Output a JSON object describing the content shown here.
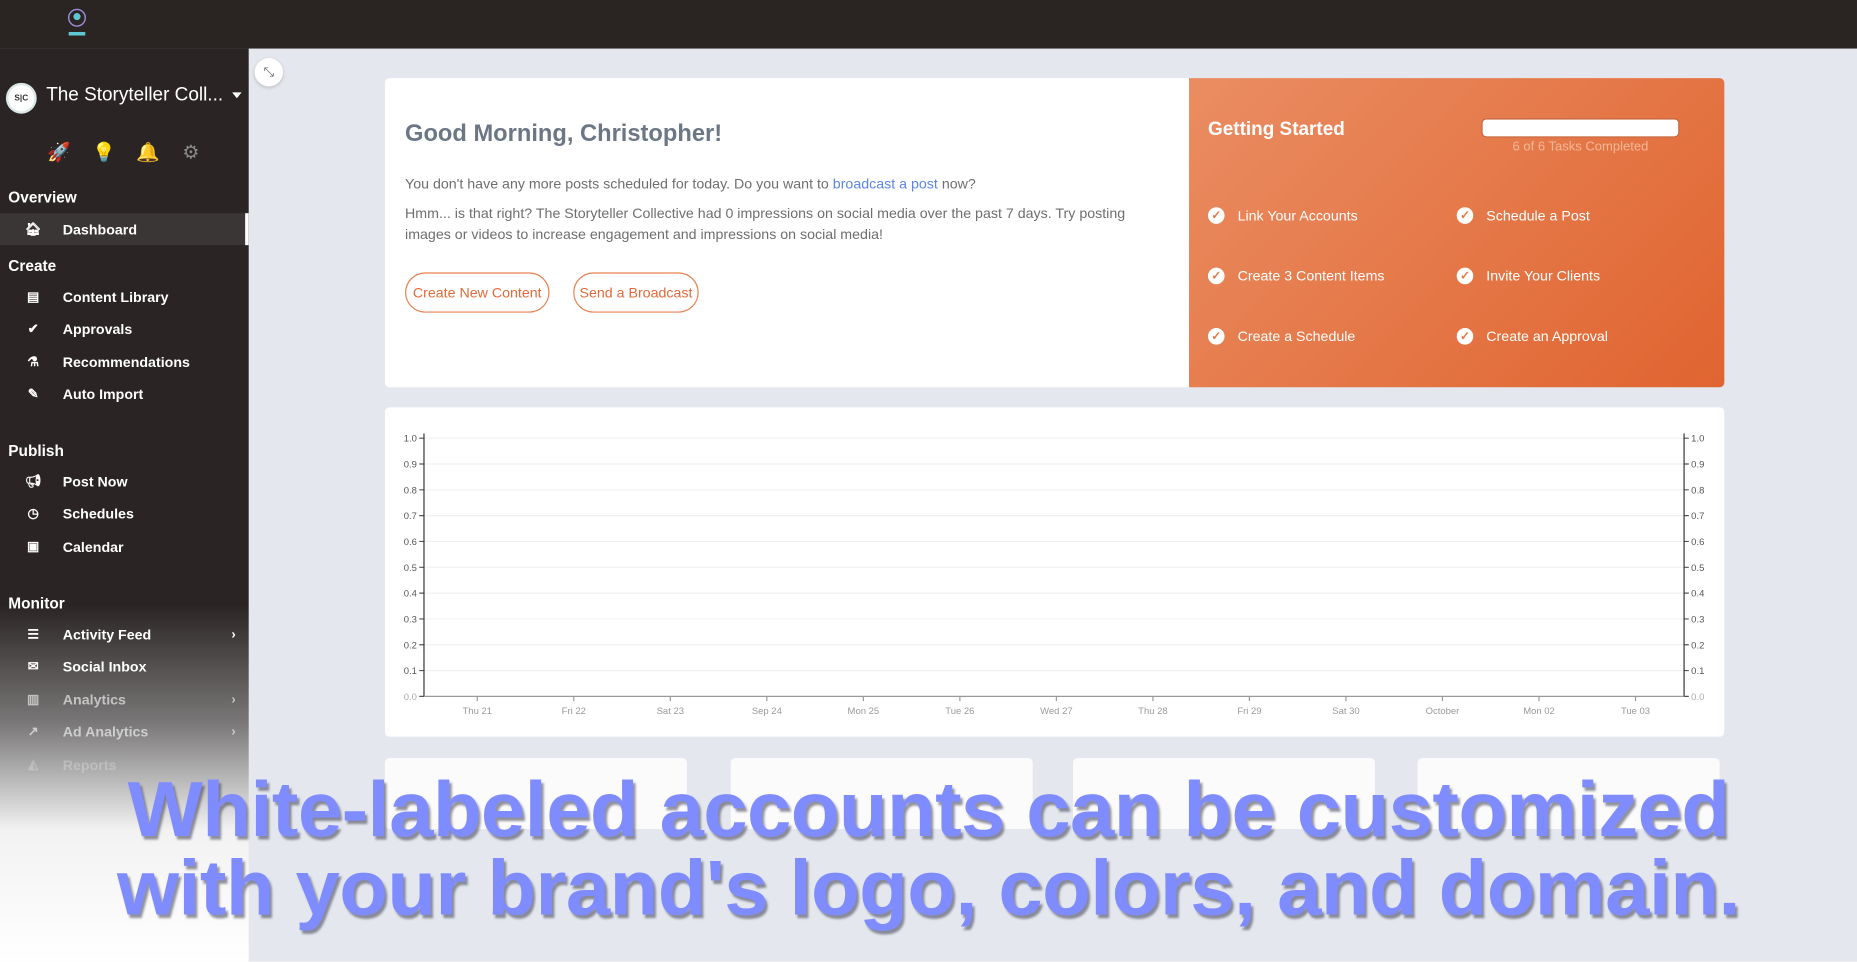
{
  "sidebar": {
    "account_initials": "S|C",
    "account_name": "The Storyteller Coll...",
    "top_icons": [
      "rocket-icon",
      "lightbulb-icon",
      "bell-icon",
      "gear-icon"
    ],
    "sections": [
      {
        "title": "Overview",
        "items": [
          {
            "label": "Dashboard",
            "icon": "home-icon",
            "active": true
          }
        ]
      },
      {
        "title": "Create",
        "items": [
          {
            "label": "Content Library",
            "icon": "image-file-icon"
          },
          {
            "label": "Approvals",
            "icon": "check-circle-icon"
          },
          {
            "label": "Recommendations",
            "icon": "flask-icon"
          },
          {
            "label": "Auto Import",
            "icon": "magic-wand-icon"
          }
        ]
      },
      {
        "title": "Publish",
        "items": [
          {
            "label": "Post Now",
            "icon": "megaphone-icon"
          },
          {
            "label": "Schedules",
            "icon": "clock-icon"
          },
          {
            "label": "Calendar",
            "icon": "calendar-check-icon"
          }
        ]
      },
      {
        "title": "Monitor",
        "items": [
          {
            "label": "Activity Feed",
            "icon": "list-icon",
            "chevron": true
          },
          {
            "label": "Social Inbox",
            "icon": "envelope-icon"
          },
          {
            "label": "Analytics",
            "icon": "bar-chart-icon",
            "chevron": true
          },
          {
            "label": "Ad Analytics",
            "icon": "line-chart-icon",
            "chevron": true
          },
          {
            "label": "Reports",
            "icon": "area-chart-icon"
          }
        ]
      }
    ]
  },
  "welcome": {
    "greeting": "Good Morning, Christopher!",
    "line1_pre": "You don't have any more posts scheduled for today. Do you want to ",
    "line1_link": "broadcast a post",
    "line1_post": " now?",
    "line2": "Hmm... is that right? The Storyteller Collective had 0 impressions on social media over the past 7 days. Try posting images or videos to increase engagement and impressions on social media!",
    "btn_create": "Create New Content",
    "btn_broadcast": "Send a Broadcast"
  },
  "getting_started": {
    "title": "Getting Started",
    "progress_percent": 100,
    "progress_text": "6 of 6 Tasks Completed",
    "tasks": [
      "Link Your Accounts",
      "Schedule a Post",
      "Create 3 Content Items",
      "Invite Your Clients",
      "Create a Schedule",
      "Create an Approval"
    ],
    "colors": {
      "start": "#ea8d62",
      "end": "#e06430"
    }
  },
  "chart_data": {
    "type": "line",
    "categories": [
      "Thu 21",
      "Fri 22",
      "Sat 23",
      "Sep 24",
      "Mon 25",
      "Tue 26",
      "Wed 27",
      "Thu 28",
      "Fri 29",
      "Sat 30",
      "October",
      "Mon 02",
      "Tue 03"
    ],
    "series": [],
    "ylim": [
      0,
      1.0
    ],
    "yticks": [
      "0.0",
      "0.1",
      "0.2",
      "0.3",
      "0.4",
      "0.5",
      "0.6",
      "0.7",
      "0.8",
      "0.9",
      "1.0"
    ],
    "grid": true,
    "dual_y_axis": true
  },
  "caption": {
    "line1": "White-labeled accounts can be customized",
    "line2": "with your brand's logo, colors, and domain.",
    "color": "#7f8cff"
  }
}
